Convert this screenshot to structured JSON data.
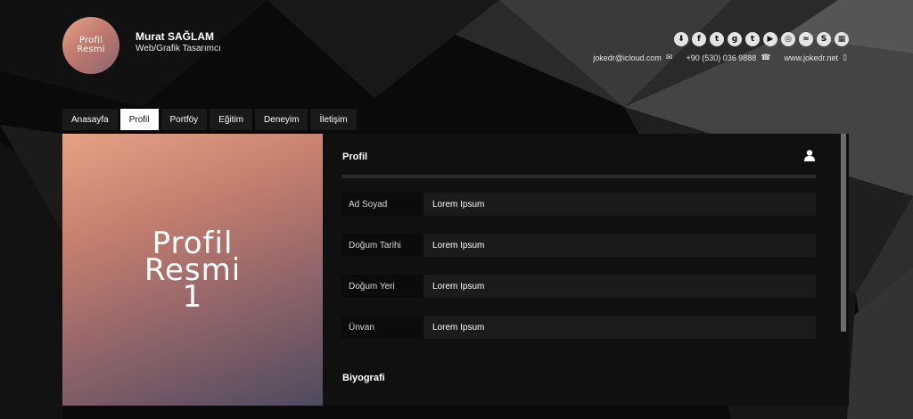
{
  "header": {
    "avatar_line1": "Profil",
    "avatar_line2": "Resmi",
    "name": "Murat SAĞLAM",
    "title": "Web/Grafik Tasarımcı",
    "social_icons": [
      "download-icon",
      "facebook-icon",
      "twitter-icon",
      "google-plus-icon",
      "tumblr-icon",
      "youtube-icon",
      "instagram-icon",
      "deviantart-icon",
      "skype-icon",
      "other-icon"
    ],
    "contact": {
      "email": "jokedr@icloud.com",
      "phone": "+90 (530) 036 9888",
      "website": "www.jokedr.net"
    }
  },
  "tabs": [
    {
      "label": "Anasayfa"
    },
    {
      "label": "Profil",
      "active": true
    },
    {
      "label": "Portföy"
    },
    {
      "label": "Eğitim"
    },
    {
      "label": "Deneyim"
    },
    {
      "label": "İletişim"
    }
  ],
  "hero": {
    "line1": "Profil",
    "line2": "Resmi",
    "line3": "1"
  },
  "profile": {
    "section_title": "Profil",
    "rows": [
      {
        "label": "Ad Soyad",
        "value": "Lorem Ipsum"
      },
      {
        "label": "Doğum Tarihi",
        "value": "Lorem Ipsum"
      },
      {
        "label": "Doğum Yeri",
        "value": "Lorem Ipsum"
      },
      {
        "label": "Ünvan",
        "value": "Lorem Ipsum"
      }
    ],
    "bio_title": "Biyografi"
  },
  "colors": {
    "background": "#0c0c0c",
    "panel": "#101010",
    "active_tab": "#ffffff"
  }
}
